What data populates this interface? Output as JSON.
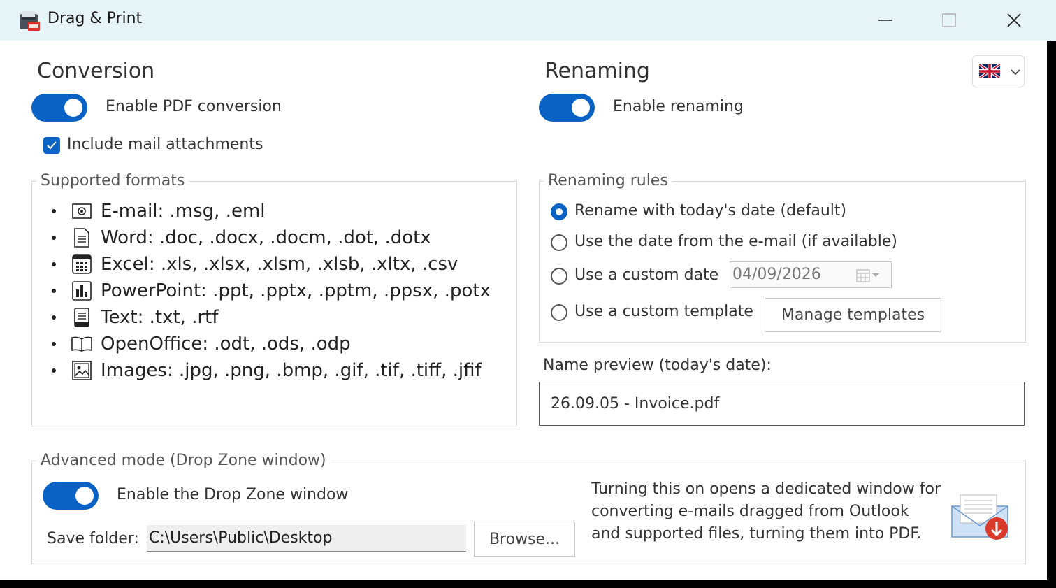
{
  "window": {
    "title": "Drag & Print"
  },
  "conversion": {
    "heading": "Conversion",
    "enable_label": "Enable PDF conversion",
    "enabled": true,
    "include_mail_label": "Include mail attachments",
    "include_mail_checked": true,
    "formats_title": "Supported formats",
    "formats": [
      {
        "icon": "email-icon",
        "text": "E-mail: .msg, .eml"
      },
      {
        "icon": "document-icon",
        "text": "Word: .doc, .docx, .docm, .dot, .dotx"
      },
      {
        "icon": "spreadsheet-icon",
        "text": "Excel: .xls, .xlsx, .xlsm, .xlsb, .xltx, .csv"
      },
      {
        "icon": "bar-chart-icon",
        "text": "PowerPoint: .ppt, .pptx, .pptm, .ppsx, .potx"
      },
      {
        "icon": "text-file-icon",
        "text": "Text: .txt, .rtf"
      },
      {
        "icon": "open-book-icon",
        "text": "OpenOffice: .odt, .ods, .odp"
      },
      {
        "icon": "image-icon",
        "text": "Images: .jpg, .png, .bmp, .gif, .tif, .tiff, .jfif"
      }
    ]
  },
  "renaming": {
    "heading": "Renaming",
    "enable_label": "Enable renaming",
    "enabled": true,
    "rules_title": "Renaming rules",
    "rules": [
      {
        "label": "Rename with today's date (default)",
        "selected": true
      },
      {
        "label": "Use the date from the e-mail (if available)",
        "selected": false
      },
      {
        "label": "Use a custom date",
        "selected": false
      },
      {
        "label": "Use a custom template",
        "selected": false
      }
    ],
    "custom_date_value": "04/09/2026",
    "manage_templates_label": "Manage templates",
    "preview_label": "Name preview (today's date):",
    "preview_value": "26.09.05 - Invoice.pdf"
  },
  "language": {
    "icon": "uk-flag-icon"
  },
  "advanced": {
    "title": "Advanced mode (Drop Zone window)",
    "enable_label": "Enable the Drop Zone window",
    "enabled": true,
    "save_folder_label": "Save folder:",
    "save_folder_value": "C:\\Users\\Public\\Desktop",
    "browse_label": "Browse...",
    "description": "Turning this on opens a dedicated window for converting e-mails dragged from Outlook and supported files, turning them into PDF.",
    "illustration_icon": "mail-download-icon"
  },
  "colors": {
    "accent": "#0a63c4",
    "titlebar": "#e6f4f8"
  }
}
